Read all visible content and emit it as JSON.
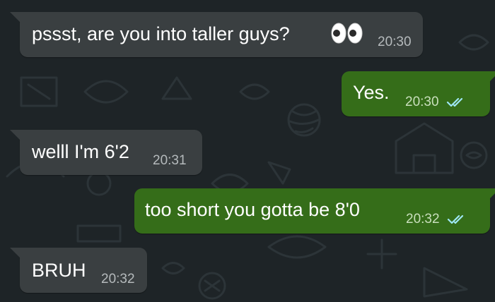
{
  "colors": {
    "wallpaper": "#1e2427",
    "incoming_bubble": "#3a3f41",
    "outgoing_bubble": "#356d19",
    "read_ticks": "#9fe7f5"
  },
  "messages": [
    {
      "direction": "incoming",
      "text": "pssst, are you into taller guys?",
      "emoji": "eyes-emoji",
      "time": "20:30"
    },
    {
      "direction": "outgoing",
      "text": "Yes.",
      "time": "20:30",
      "status": "read"
    },
    {
      "direction": "incoming",
      "text": "welll I'm 6'2",
      "time": "20:31"
    },
    {
      "direction": "outgoing",
      "text": "too short you gotta be 8'0",
      "time": "20:32",
      "status": "read"
    },
    {
      "direction": "incoming",
      "text": "BRUH",
      "time": "20:32"
    }
  ]
}
